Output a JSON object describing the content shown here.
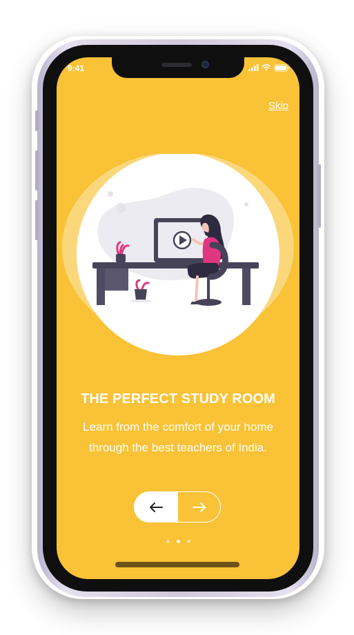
{
  "status_bar": {
    "time": "9:41",
    "icons": [
      "cellular-signal-icon",
      "wifi-icon",
      "battery-icon"
    ]
  },
  "header": {
    "skip_label": "Skip"
  },
  "onboarding": {
    "illustration": "woman-at-desk-watching-video-illustration",
    "title": "THE PERFECT STUDY ROOM",
    "description": "Learn from the comfort of your home through the best teachers of India.",
    "prev_icon": "arrow-left-icon",
    "next_icon": "arrow-right-icon",
    "pagination": {
      "total": 3,
      "current": 2
    }
  },
  "colors": {
    "background": "#f9c237",
    "text": "#ffffff",
    "accent_figure": "#e0367f",
    "illustration_dark": "#474359"
  }
}
